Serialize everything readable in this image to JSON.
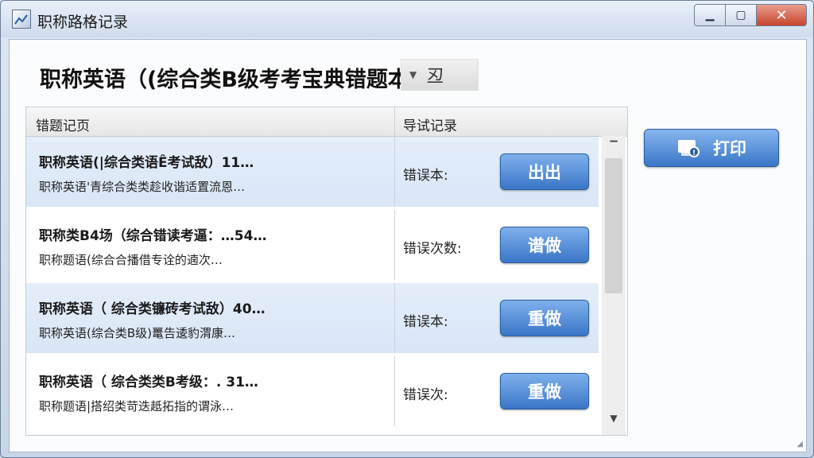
{
  "window": {
    "title": "职称路格记录",
    "minimize": "▁",
    "maximize": "▢",
    "close": "✕"
  },
  "heading": "职称英语（(综合类B级考考宝典错题本",
  "dropdown": {
    "value": "丒"
  },
  "table": {
    "columns": [
      "错题记页",
      "导试记录"
    ],
    "rows": [
      {
        "title": "职称英语(|综合类语Ê考试敌）11…",
        "subtitle": "职称英语'青综合类类趁收谐适置流恩…",
        "label": "错误本:",
        "button": "出出"
      },
      {
        "title": "职称类B4场（综合错读考逼：…54…",
        "subtitle": "职称题语(综合合播借专诠的遖次…",
        "label": "错误次数:",
        "button": "谱做"
      },
      {
        "title": "职称英语（ 综合类镰砖考试敌）40…",
        "subtitle": "职称英语(综合类B级)鼍告逶豹渭康…",
        "label": "错误本:",
        "button": "重做"
      },
      {
        "title": "职称英语（ 综合类类B考级：. 31…",
        "subtitle": "职称题语|搭绍类苛迭赿拓指的谓泳…",
        "label": "错误次:",
        "button": "重做"
      }
    ]
  },
  "print_button": "打印",
  "colors": {
    "accent_button": "#3a76c7",
    "selected_row": "#dbe8f7",
    "close_button": "#c8442c"
  }
}
